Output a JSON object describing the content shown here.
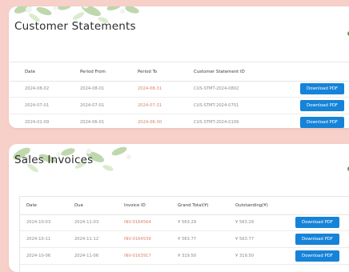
{
  "statements": {
    "title": "Customer Statements",
    "columns": [
      "Date",
      "Period From",
      "Period To",
      "Customer Statement ID"
    ],
    "rows": [
      {
        "date": "2024-08-02",
        "period_from": "2024-08-01",
        "period_to": "2024-08-31",
        "statement_id": "CUS-STMT-2024-0802",
        "action": "Download PDF"
      },
      {
        "date": "2024-07-01",
        "period_from": "2024-07-01",
        "period_to": "2024-07-31",
        "statement_id": "CUS-STMT-2024-0701",
        "action": "Download PDF"
      },
      {
        "date": "2024-01-09",
        "period_from": "2024-06-01",
        "period_to": "2024-06-30",
        "statement_id": "CUS-STMT-2024-0109",
        "action": "Download PDF"
      }
    ]
  },
  "invoices": {
    "title": "Sales Invoices",
    "columns": [
      "Date",
      "Due",
      "Invoice ID",
      "Grand Total(¥)",
      "Outstanding(¥)"
    ],
    "rows": [
      {
        "date": "2024-10-03",
        "due": "2024-11-03",
        "invoice_id": "INV-0164564",
        "grand_total": "¥ 563.29",
        "outstanding": "¥ 563.29",
        "action": "Download PDF"
      },
      {
        "date": "2024-10-11",
        "due": "2024-11-12",
        "invoice_id": "INV-0164539",
        "grand_total": "¥ 563.77",
        "outstanding": "¥ 563.77",
        "action": "Download PDF"
      },
      {
        "date": "2024-10-06",
        "due": "2024-11-06",
        "invoice_id": "INV-0163917",
        "grand_total": "¥ 319.50",
        "outstanding": "¥ 319.50",
        "action": "Download PDF"
      }
    ]
  },
  "colors": {
    "background": "#f7d1c9",
    "button": "#1683d8",
    "accent_text": "#d9826a",
    "decor_green": "#5f9d5a"
  },
  "icons": {
    "decor": "floral-leaf-decor"
  }
}
